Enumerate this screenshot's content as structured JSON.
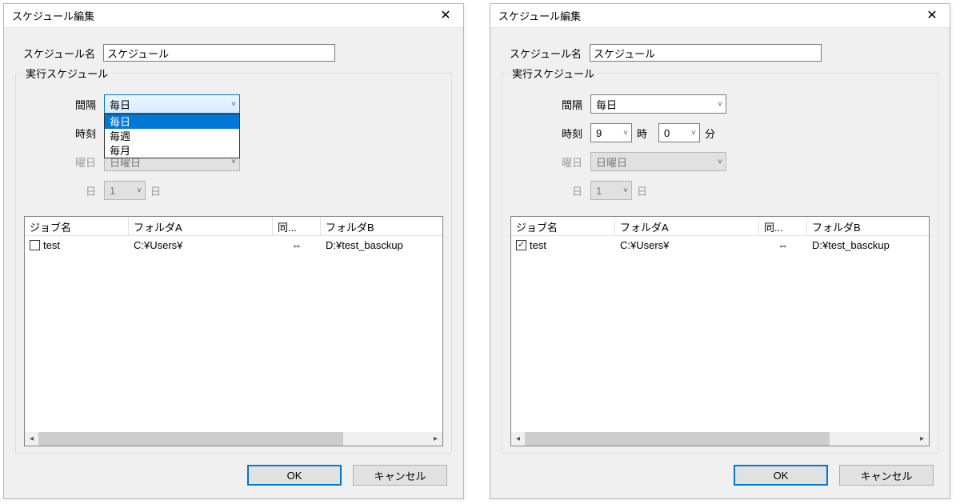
{
  "left": {
    "title": "スケジュール編集",
    "name_label": "スケジュール名",
    "name_value": "スケジュール",
    "group_legend": "実行スケジュール",
    "interval_label": "間隔",
    "interval_value": "毎日",
    "interval_options": [
      "毎日",
      "毎週",
      "毎月"
    ],
    "time_label": "時刻",
    "weekday_label": "曜日",
    "weekday_value": "日曜日",
    "day_label": "日",
    "day_value": "1",
    "day_unit": "日",
    "columns": {
      "job": "ジョブ名",
      "folderA": "フォルダA",
      "sync": "同...",
      "folderB": "フォルダB"
    },
    "row": {
      "job": "test",
      "folderA": "C:¥Users¥",
      "sync": "⇔",
      "folderB": "D:¥test_basckup"
    },
    "ok": "OK",
    "cancel": "キャンセル"
  },
  "right": {
    "title": "スケジュール編集",
    "name_label": "スケジュール名",
    "name_value": "スケジュール",
    "group_legend": "実行スケジュール",
    "interval_label": "間隔",
    "interval_value": "毎日",
    "time_label": "時刻",
    "hour_value": "9",
    "hour_unit": "時",
    "minute_value": "0",
    "minute_unit": "分",
    "weekday_label": "曜日",
    "weekday_value": "日曜日",
    "day_label": "日",
    "day_value": "1",
    "day_unit": "日",
    "columns": {
      "job": "ジョブ名",
      "folderA": "フォルダA",
      "sync": "同...",
      "folderB": "フォルダB"
    },
    "row": {
      "job": "test",
      "folderA": "C:¥Users¥",
      "sync": "⇔",
      "folderB": "D:¥test_basckup"
    },
    "ok": "OK",
    "cancel": "キャンセル"
  }
}
